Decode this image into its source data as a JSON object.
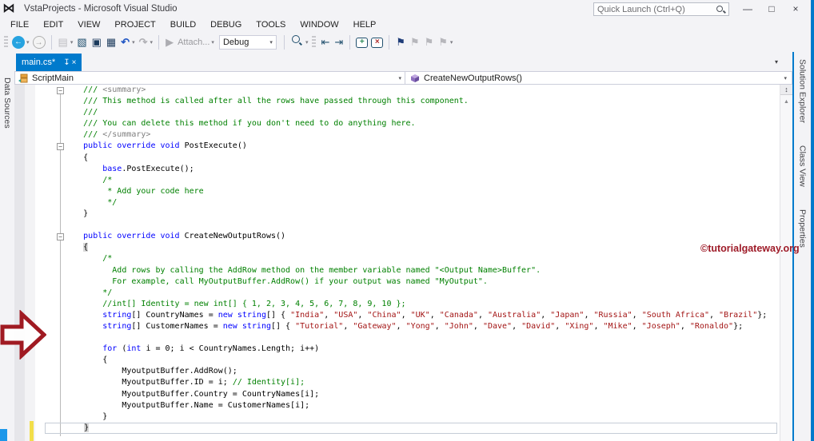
{
  "window": {
    "title": "VstaProjects - Microsoft Visual Studio",
    "quick_launch": "Quick Launch (Ctrl+Q)",
    "controls": {
      "minimize": "—",
      "maximize": "□",
      "close": "×"
    },
    "logo_glyph": "⋈"
  },
  "menu": {
    "items": [
      "FILE",
      "EDIT",
      "VIEW",
      "PROJECT",
      "BUILD",
      "DEBUG",
      "TOOLS",
      "WINDOW",
      "HELP"
    ]
  },
  "toolbar": {
    "attach_label": "Attach...",
    "debug_target": "Debug",
    "items": [
      {
        "type": "grip"
      },
      {
        "type": "circle",
        "name": "navigate-backward-button",
        "glyph": "←",
        "bg": "#27a3e0",
        "fg": "#ffffff"
      },
      {
        "type": "caret",
        "name": "navigate-backward-dropdown"
      },
      {
        "type": "circle",
        "name": "navigate-forward-button",
        "glyph": "→",
        "bg": "#f4f4f4",
        "fg": "#9e9e9e",
        "border": "#afafaf"
      },
      {
        "type": "sep"
      },
      {
        "type": "icon",
        "name": "new-file-button",
        "glyph": "▤",
        "color": "#bdbdc2"
      },
      {
        "type": "caret",
        "name": "new-file-dropdown"
      },
      {
        "type": "icon",
        "name": "open-file-button",
        "glyph": "▧",
        "color": "#21506e"
      },
      {
        "type": "icon",
        "name": "save-button",
        "glyph": "▣",
        "color": "#1b3a5c"
      },
      {
        "type": "icon",
        "name": "save-all-button",
        "glyph": "▦",
        "color": "#1b3a5c"
      },
      {
        "type": "icon",
        "name": "undo-button",
        "glyph": "↶",
        "color": "#2257c4",
        "bold": true
      },
      {
        "type": "caret",
        "name": "undo-dropdown"
      },
      {
        "type": "icon",
        "name": "redo-button",
        "glyph": "↷",
        "color": "#b1b1b6",
        "bold": true
      },
      {
        "type": "caret",
        "name": "redo-dropdown"
      },
      {
        "type": "sep"
      },
      {
        "type": "icon",
        "name": "attach-play-icon",
        "glyph": "▶",
        "color": "#acacb1"
      },
      {
        "type": "label",
        "name": "attach-button"
      },
      {
        "type": "caret",
        "name": "attach-dropdown"
      },
      {
        "type": "combo",
        "name": "debug-target-combo"
      },
      {
        "type": "sep"
      },
      {
        "type": "find",
        "name": "find-in-files-button"
      },
      {
        "type": "caret",
        "name": "find-overflow"
      },
      {
        "type": "grip"
      },
      {
        "type": "icon",
        "name": "indent-decrease-button",
        "glyph": "⇤",
        "color": "#21506e"
      },
      {
        "type": "icon",
        "name": "indent-increase-button",
        "glyph": "⇥",
        "color": "#21506e"
      },
      {
        "type": "sep"
      },
      {
        "type": "bubble",
        "name": "add-comment-button",
        "glyph": "+",
        "color": "#2e8b57"
      },
      {
        "type": "bubble",
        "name": "delete-comment-button",
        "glyph": "×",
        "color": "#b03030"
      },
      {
        "type": "sep"
      },
      {
        "type": "icon",
        "name": "toggle-bookmark-button",
        "glyph": "⚑",
        "color": "#1e3c78"
      },
      {
        "type": "icon",
        "name": "previous-bookmark-button",
        "glyph": "⚑",
        "color": "#b7b7bc"
      },
      {
        "type": "icon",
        "name": "next-bookmark-button",
        "glyph": "⚑",
        "color": "#b7b7bc"
      },
      {
        "type": "icon",
        "name": "clear-bookmarks-button",
        "glyph": "⚑",
        "color": "#b7b7bc"
      },
      {
        "type": "caret",
        "name": "bookmark-overflow"
      }
    ]
  },
  "left_strip": {
    "tabs": [
      "Data Sources"
    ]
  },
  "right_strip": {
    "tabs": [
      "Solution Explorer",
      "Class View",
      "Properties"
    ]
  },
  "editor": {
    "tab": {
      "label": "main.cs*",
      "pin_icon": "↧",
      "close_icon": "×"
    },
    "nav": {
      "class_name": "ScriptMain",
      "method_name": "CreateNewOutputRows()"
    },
    "watermark": "©tutorialgateway.org",
    "fold_lines": [
      0,
      5,
      13
    ],
    "current_line": 30,
    "lines": [
      [
        [
          "c",
          "        /// "
        ],
        [
          "g",
          "<summary>"
        ]
      ],
      [
        [
          "c",
          "        /// This method is called after all the rows have passed through this component."
        ]
      ],
      [
        [
          "c",
          "        ///"
        ]
      ],
      [
        [
          "c",
          "        /// You can delete this method if you don't need to do anything here."
        ]
      ],
      [
        [
          "c",
          "        /// "
        ],
        [
          "g",
          "</summary>"
        ]
      ],
      [
        [
          "k",
          "        public override void"
        ],
        [
          "t",
          " PostExecute()"
        ]
      ],
      [
        [
          "t",
          "        {"
        ]
      ],
      [
        [
          "t",
          "            "
        ],
        [
          "k",
          "base"
        ],
        [
          "t",
          ".PostExecute();"
        ]
      ],
      [
        [
          "c",
          "            /*"
        ]
      ],
      [
        [
          "c",
          "             * Add your code here"
        ]
      ],
      [
        [
          "c",
          "             */"
        ]
      ],
      [
        [
          "t",
          "        }"
        ]
      ],
      [],
      [
        [
          "k",
          "        public override void"
        ],
        [
          "t",
          " CreateNewOutputRows()"
        ]
      ],
      [
        [
          "t",
          "        "
        ],
        [
          "b",
          "{"
        ]
      ],
      [
        [
          "c",
          "            /*"
        ]
      ],
      [
        [
          "c",
          "              Add rows by calling the AddRow method on the member variable named \"<Output Name>Buffer\"."
        ]
      ],
      [
        [
          "c",
          "              For example, call MyOutputBuffer.AddRow() if your output was named \"MyOutput\"."
        ]
      ],
      [
        [
          "c",
          "            */"
        ]
      ],
      [
        [
          "c",
          "            //int[] Identity = new int[] { 1, 2, 3, 4, 5, 6, 7, 8, 9, 10 };"
        ]
      ],
      [
        [
          "k",
          "            string"
        ],
        [
          "t",
          "[] CountryNames = "
        ],
        [
          "k",
          "new"
        ],
        [
          "t",
          " "
        ],
        [
          "k",
          "string"
        ],
        [
          "t",
          "[] { "
        ],
        [
          "s",
          "\"India\""
        ],
        [
          "t",
          ", "
        ],
        [
          "s",
          "\"USA\""
        ],
        [
          "t",
          ", "
        ],
        [
          "s",
          "\"China\""
        ],
        [
          "t",
          ", "
        ],
        [
          "s",
          "\"UK\""
        ],
        [
          "t",
          ", "
        ],
        [
          "s",
          "\"Canada\""
        ],
        [
          "t",
          ", "
        ],
        [
          "s",
          "\"Australia\""
        ],
        [
          "t",
          ", "
        ],
        [
          "s",
          "\"Japan\""
        ],
        [
          "t",
          ", "
        ],
        [
          "s",
          "\"Russia\""
        ],
        [
          "t",
          ", "
        ],
        [
          "s",
          "\"South Africa\""
        ],
        [
          "t",
          ", "
        ],
        [
          "s",
          "\"Brazil\""
        ],
        [
          "t",
          "};"
        ]
      ],
      [
        [
          "k",
          "            string"
        ],
        [
          "t",
          "[] CustomerNames = "
        ],
        [
          "k",
          "new"
        ],
        [
          "t",
          " "
        ],
        [
          "k",
          "string"
        ],
        [
          "t",
          "[] { "
        ],
        [
          "s",
          "\"Tutorial\""
        ],
        [
          "t",
          ", "
        ],
        [
          "s",
          "\"Gateway\""
        ],
        [
          "t",
          ", "
        ],
        [
          "s",
          "\"Yong\""
        ],
        [
          "t",
          ", "
        ],
        [
          "s",
          "\"John\""
        ],
        [
          "t",
          ", "
        ],
        [
          "s",
          "\"Dave\""
        ],
        [
          "t",
          ", "
        ],
        [
          "s",
          "\"David\""
        ],
        [
          "t",
          ", "
        ],
        [
          "s",
          "\"Xing\""
        ],
        [
          "t",
          ", "
        ],
        [
          "s",
          "\"Mike\""
        ],
        [
          "t",
          ", "
        ],
        [
          "s",
          "\"Joseph\""
        ],
        [
          "t",
          ", "
        ],
        [
          "s",
          "\"Ronaldo\""
        ],
        [
          "t",
          "};"
        ]
      ],
      [],
      [
        [
          "k",
          "            for"
        ],
        [
          "t",
          " ("
        ],
        [
          "k",
          "int"
        ],
        [
          "t",
          " i = 0; i < CountryNames.Length; i++)"
        ]
      ],
      [
        [
          "t",
          "            {"
        ]
      ],
      [
        [
          "t",
          "                MyoutputBuffer.AddRow();"
        ]
      ],
      [
        [
          "t",
          "                MyoutputBuffer.ID = i; "
        ],
        [
          "c",
          "// Identity[i];"
        ]
      ],
      [
        [
          "t",
          "                MyoutputBuffer.Country = CountryNames[i];"
        ]
      ],
      [
        [
          "t",
          "                MyoutputBuffer.Name = CustomerNames[i];"
        ]
      ],
      [
        [
          "t",
          "            }"
        ]
      ],
      [
        [
          "t",
          "        "
        ],
        [
          "b",
          "}"
        ]
      ]
    ]
  },
  "colors": {
    "accent": "#007acc",
    "keyword": "#0000ff",
    "comment": "#008000",
    "string": "#a31515",
    "xml_tag": "#808080",
    "watermark_red": "#9e1b28",
    "modified_yellow": "#f2de4a"
  }
}
